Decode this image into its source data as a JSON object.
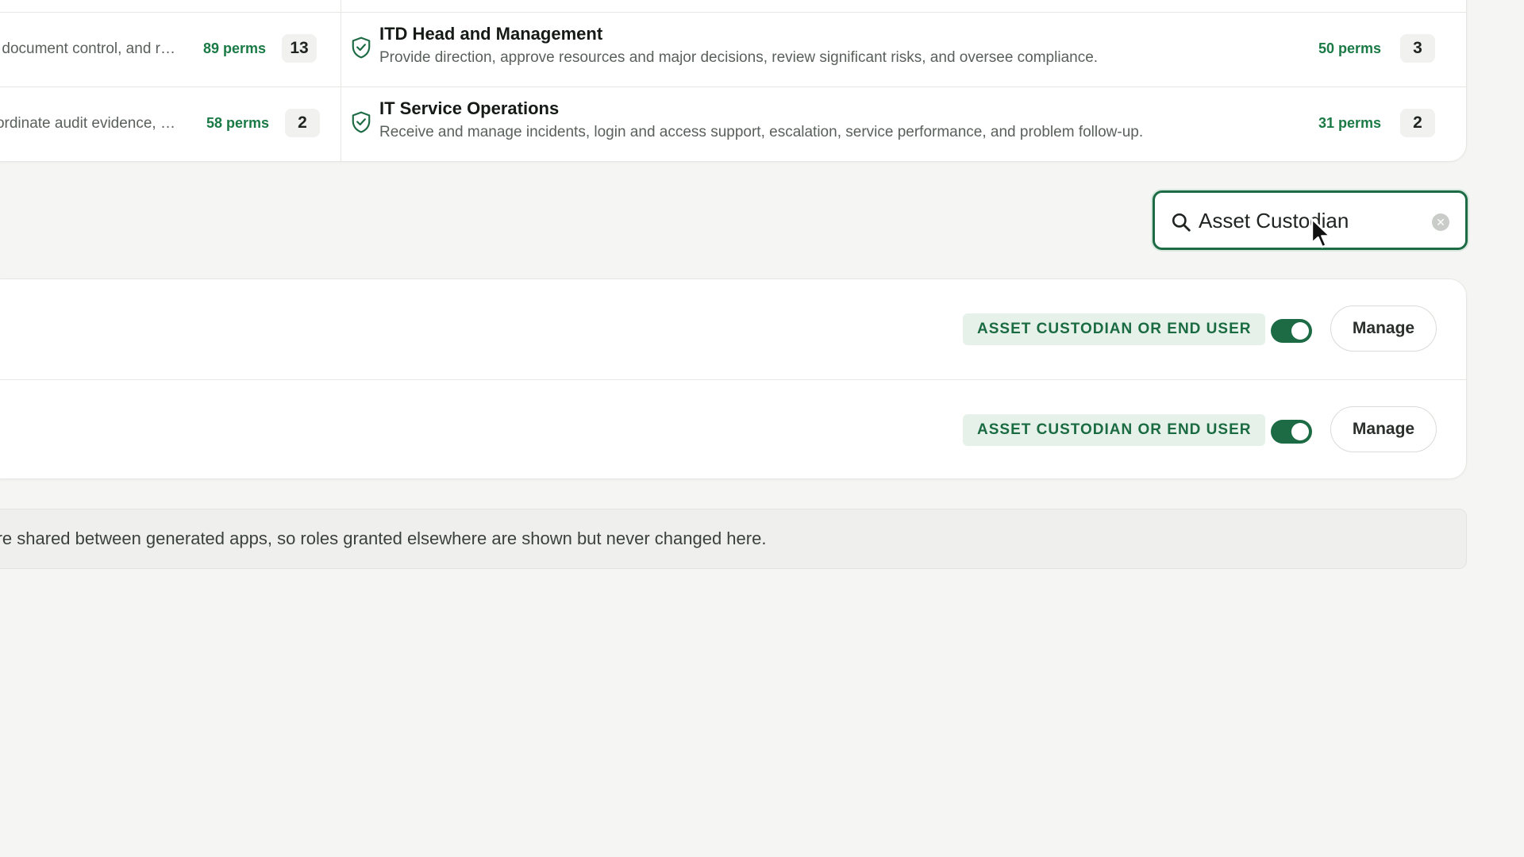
{
  "role_cards": {
    "rows": [
      {
        "left": {
          "description": "…n, document control, and r…",
          "perms": "89 perms",
          "count": "13"
        },
        "right": {
          "title": "ITD Head and Management",
          "description": "Provide direction, approve resources and major decisions, review significant risks, and oversee compliance.",
          "perms": "50 perms",
          "count": "3"
        }
      },
      {
        "left": {
          "description": "oordinate audit evidence, …",
          "perms": "58 perms",
          "count": "2"
        },
        "right": {
          "title": "IT Service Operations",
          "description": "Receive and manage incidents, login and access support, escalation, service performance, and problem follow-up.",
          "perms": "31 perms",
          "count": "2"
        }
      }
    ]
  },
  "search": {
    "value": "Asset Custodian",
    "icon": "search-icon",
    "clear_icon": "clear-icon"
  },
  "results": [
    {
      "role_label": "ASSET CUSTODIAN OR END USER",
      "enabled": true,
      "manage_label": "Manage"
    },
    {
      "role_label": "ASSET CUSTODIAN OR END USER",
      "enabled": true,
      "manage_label": "Manage"
    }
  ],
  "info_note": {
    "text": "Roles are shared between generated apps, so roles granted elsewhere are shown but never changed here."
  },
  "colors": {
    "accent": "#1d6b45",
    "perms_text": "#1a7a45",
    "chip_bg": "#e6f1ea",
    "page_bg": "#f5f5f3"
  }
}
